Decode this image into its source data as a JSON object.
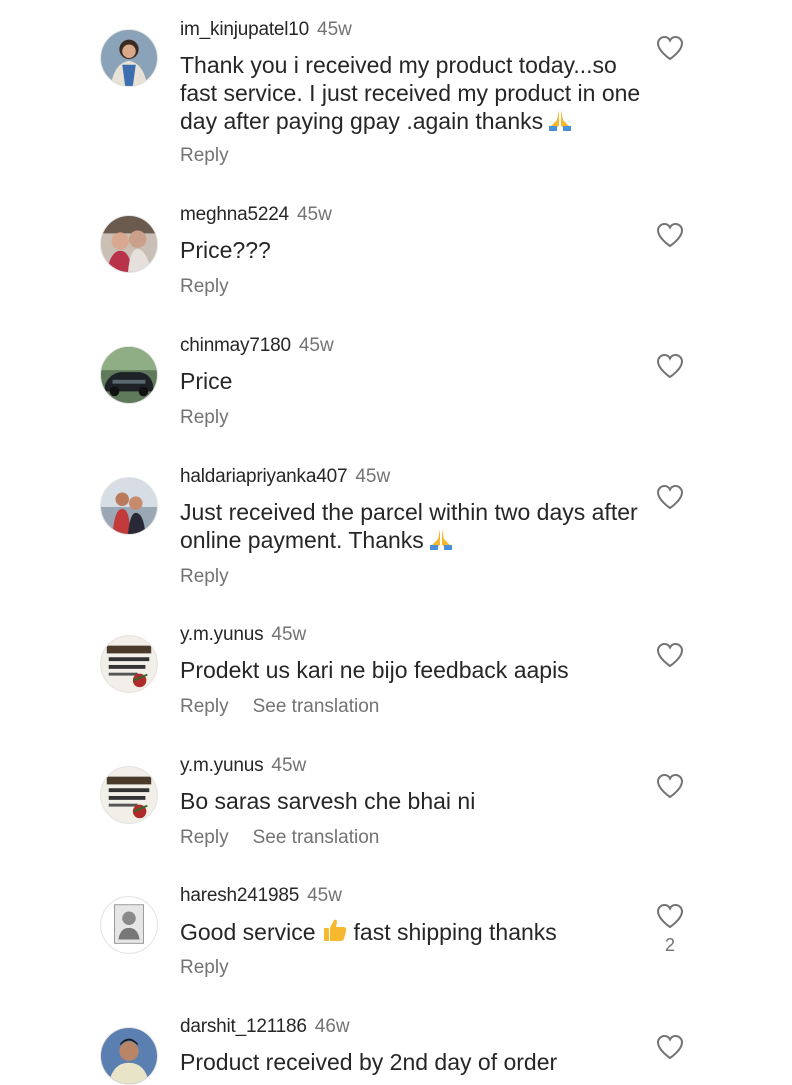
{
  "comments": [
    {
      "username": "im_kinjupatel10",
      "time": "45w",
      "text": "Thank you  i received my product today...so fast service. I just received my product in one day after paying gpay .again thanks",
      "reply": "Reply"
    },
    {
      "username": "meghna5224",
      "time": "45w",
      "text": "Price???",
      "reply": "Reply"
    },
    {
      "username": "chinmay7180",
      "time": "45w",
      "text": "Price",
      "reply": "Reply"
    },
    {
      "username": "haldariapriyanka407",
      "time": "45w",
      "text": "Just received the parcel within  two days after online payment. Thanks",
      "reply": "Reply"
    },
    {
      "username": "y.m.yunus",
      "time": "45w",
      "text": "Prodekt us kari ne bijo feedback aapis",
      "reply": "Reply",
      "translate": "See translation"
    },
    {
      "username": "y.m.yunus",
      "time": "45w",
      "text": "Bo saras sarvesh che bhai ni",
      "reply": "Reply",
      "translate": "See translation"
    },
    {
      "username": "haresh241985",
      "time": "45w",
      "text_before": "Good service",
      "text_after": "fast shipping thanks",
      "reply": "Reply",
      "likes": "2"
    },
    {
      "username": "darshit_121186",
      "time": "46w",
      "text": "Product received by 2nd day of order"
    }
  ],
  "icons": {
    "like": "heart-outline-icon",
    "pray": "folded-hands-emoji",
    "thumbs": "thumbs-up-emoji"
  },
  "colors": {
    "primary_text": "#262626",
    "secondary_text": "#737373",
    "emoji_yellow": "#f5b82e"
  }
}
